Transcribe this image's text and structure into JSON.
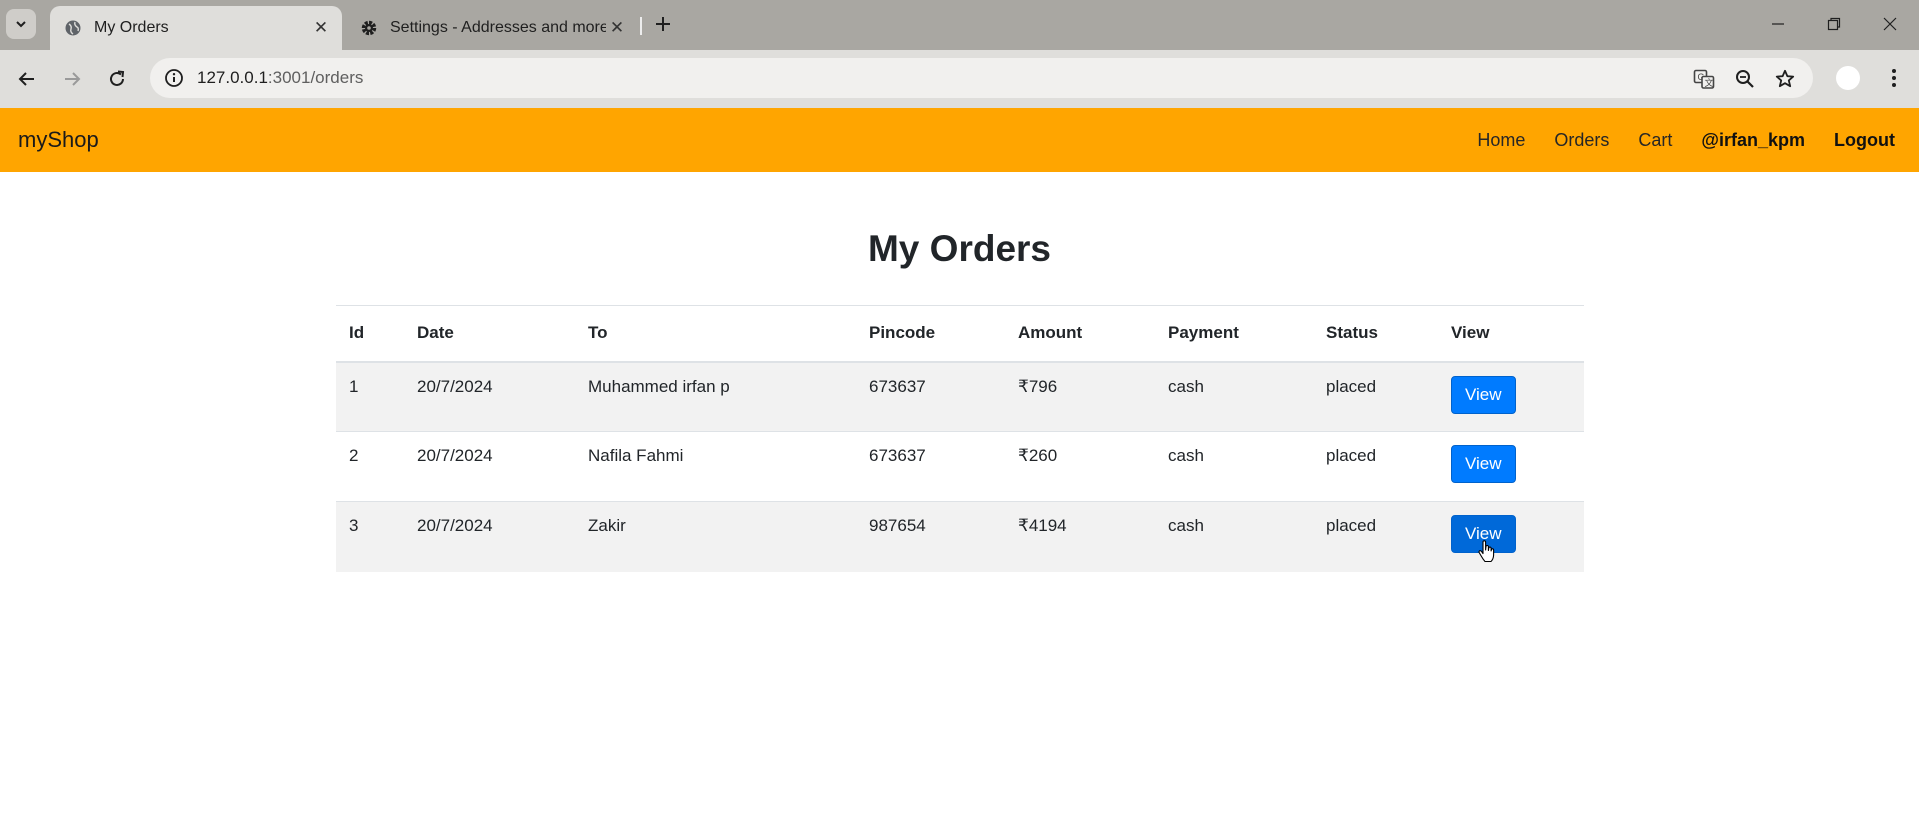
{
  "browser": {
    "tabs": [
      {
        "title": "My Orders",
        "active": true,
        "icon": "globe-icon"
      },
      {
        "title": "Settings - Addresses and more",
        "active": false,
        "icon": "gear-icon"
      }
    ],
    "url_host": "127.0.0.1",
    "url_path": ":3001/orders"
  },
  "navbar": {
    "brand": "myShop",
    "links": {
      "home": "Home",
      "orders": "Orders",
      "cart": "Cart",
      "user": "@irfan_kpm",
      "logout": "Logout"
    }
  },
  "page": {
    "title": "My Orders"
  },
  "table": {
    "headers": [
      "Id",
      "Date",
      "To",
      "Pincode",
      "Amount",
      "Payment",
      "Status",
      "View"
    ],
    "rows": [
      {
        "id": "1",
        "date": "20/7/2024",
        "to": "Muhammed irfan p",
        "pincode": "673637",
        "amount": "₹796",
        "payment": "cash",
        "status": "placed",
        "action": "View"
      },
      {
        "id": "2",
        "date": "20/7/2024",
        "to": "Nafila Fahmi",
        "pincode": "673637",
        "amount": "₹260",
        "payment": "cash",
        "status": "placed",
        "action": "View"
      },
      {
        "id": "3",
        "date": "20/7/2024",
        "to": "Zakir",
        "pincode": "987654",
        "amount": "₹4194",
        "payment": "cash",
        "status": "placed",
        "action": "View"
      }
    ]
  },
  "colors": {
    "navbar_bg": "#ffa500",
    "button_primary": "#007bff",
    "stripe": "#f2f2f2"
  }
}
